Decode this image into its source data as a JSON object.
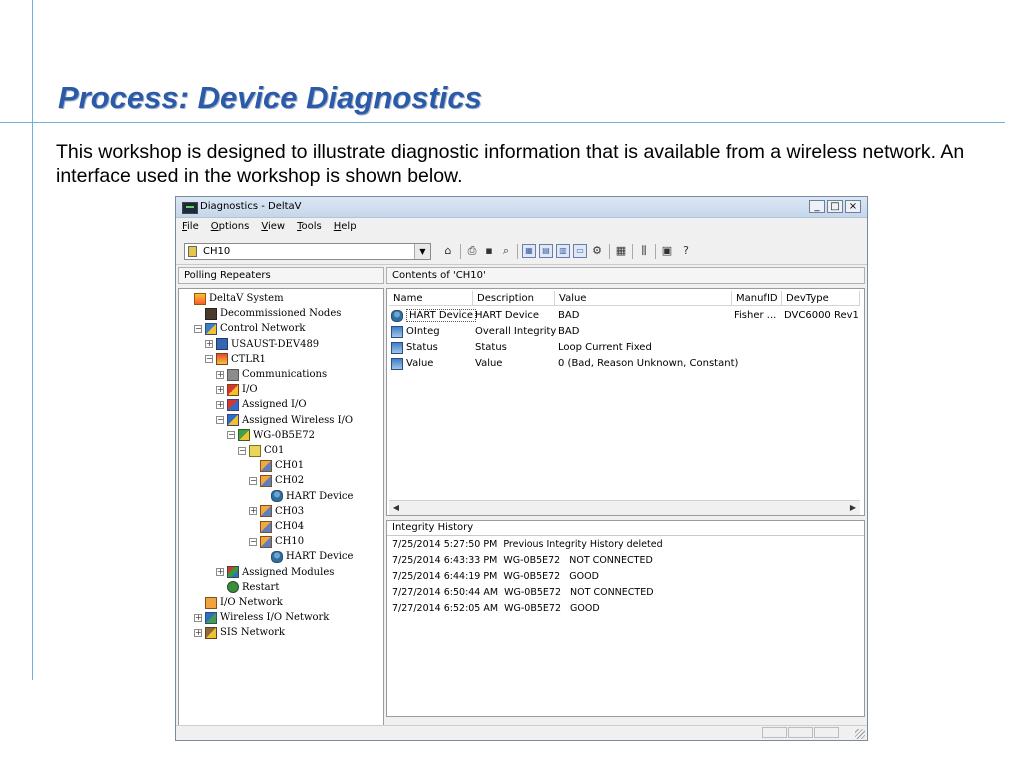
{
  "slide": {
    "title": "Process: Device Diagnostics",
    "body": "This workshop is designed to illustrate diagnostic information that is available from a wireless network. An interface used in the workshop is shown below."
  },
  "window": {
    "title": "Diagnostics - DeltaV",
    "buttons": {
      "minimize": "_",
      "maximize": "□",
      "close": "×"
    },
    "menu": [
      {
        "first": "F",
        "rest": "ile"
      },
      {
        "first": "O",
        "rest": "ptions"
      },
      {
        "first": "V",
        "rest": "iew"
      },
      {
        "first": "T",
        "rest": "ools"
      },
      {
        "first": "H",
        "rest": "elp"
      }
    ],
    "combo_value": "CH10",
    "help_glyph": "?"
  },
  "left_pane": {
    "header": "Polling Repeaters",
    "tree": [
      {
        "label": "DeltaV System",
        "icon": "system-icon",
        "expander": ""
      },
      {
        "label": "Decommissioned Nodes",
        "icon": "decommissioned-nodes-icon",
        "expander": ""
      },
      {
        "label": "Control Network",
        "icon": "control-network-icon",
        "expander": "−"
      },
      {
        "label": "USAUST-DEV489",
        "icon": "workstation-icon",
        "expander": "+"
      },
      {
        "label": "CTLR1",
        "icon": "controller-icon",
        "expander": "−"
      },
      {
        "label": "Communications",
        "icon": "communications-icon",
        "expander": "+"
      },
      {
        "label": "I/O",
        "icon": "io-icon",
        "expander": "+"
      },
      {
        "label": "Assigned I/O",
        "icon": "assigned-io-icon",
        "expander": "+"
      },
      {
        "label": "Assigned Wireless I/O",
        "icon": "assigned-wireless-io-icon",
        "expander": "−"
      },
      {
        "label": "WG-0B5E72",
        "icon": "gateway-icon",
        "expander": "−"
      },
      {
        "label": "C01",
        "icon": "card-icon",
        "expander": "−"
      },
      {
        "label": "CH01",
        "icon": "channel-icon",
        "expander": ""
      },
      {
        "label": "CH02",
        "icon": "channel-icon",
        "expander": "−"
      },
      {
        "label": "HART Device",
        "icon": "hart-device-icon",
        "expander": ""
      },
      {
        "label": "CH03",
        "icon": "channel-icon",
        "expander": "+"
      },
      {
        "label": "CH04",
        "icon": "channel-icon",
        "expander": ""
      },
      {
        "label": "CH10",
        "icon": "channel-icon",
        "expander": "−"
      },
      {
        "label": "HART Device",
        "icon": "hart-device-icon",
        "expander": ""
      },
      {
        "label": "Assigned Modules",
        "icon": "assigned-modules-icon",
        "expander": "+"
      },
      {
        "label": "Restart",
        "icon": "restart-icon",
        "expander": ""
      },
      {
        "label": "I/O Network",
        "icon": "io-network-icon",
        "expander": ""
      },
      {
        "label": "Wireless I/O Network",
        "icon": "wireless-io-network-icon",
        "expander": "+"
      },
      {
        "label": "SIS Network",
        "icon": "sis-network-icon",
        "expander": "+"
      }
    ]
  },
  "right_pane": {
    "header": "Contents of 'CH10'",
    "columns": [
      "Name",
      "Description",
      "Value",
      "ManufID",
      "DevType"
    ],
    "rows": [
      {
        "name": "HART Device",
        "description": "HART Device",
        "value": "BAD",
        "manuf": "Fisher ...",
        "devtype": "DVC6000 Rev1",
        "icon": "hart-device-icon"
      },
      {
        "name": "OInteg",
        "description": "Overall Integrity",
        "value": "BAD",
        "manuf": "",
        "devtype": "",
        "icon": "parameter-icon"
      },
      {
        "name": "Status",
        "description": "Status",
        "value": "Loop Current Fixed",
        "manuf": "",
        "devtype": "",
        "icon": "parameter-icon"
      },
      {
        "name": "Value",
        "description": "Value",
        "value": "0 (Bad, Reason Unknown, Constant)",
        "manuf": "",
        "devtype": "",
        "icon": "parameter-icon"
      }
    ],
    "history_title": "Integrity History",
    "history": [
      "7/25/2014 5:27:50 PM  Previous Integrity History deleted",
      "7/25/2014 6:43:33 PM  WG-0B5E72   NOT CONNECTED",
      "7/25/2014 6:44:19 PM  WG-0B5E72   GOOD",
      "7/27/2014 6:50:44 AM  WG-0B5E72   NOT CONNECTED",
      "7/27/2014 6:52:05 AM  WG-0B5E72   GOOD"
    ]
  }
}
